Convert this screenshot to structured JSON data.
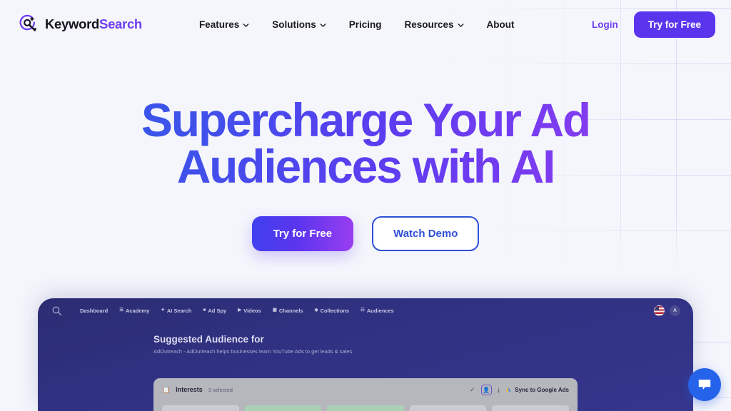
{
  "brand": {
    "name_dark": "Keyword",
    "name_accent": "Search",
    "logo_icon": "target-search-logo"
  },
  "nav": {
    "items": [
      {
        "label": "Features",
        "has_caret": true
      },
      {
        "label": "Solutions",
        "has_caret": true
      },
      {
        "label": "Pricing",
        "has_caret": false
      },
      {
        "label": "Resources",
        "has_caret": true
      },
      {
        "label": "About",
        "has_caret": false
      }
    ],
    "login_label": "Login",
    "cta_label": "Try for Free"
  },
  "hero": {
    "headline": "Supercharge Your Ad Audiences with AI",
    "primary_cta": "Try for Free",
    "secondary_cta": "Watch Demo"
  },
  "dashboard": {
    "search_icon": "search-icon",
    "links": [
      {
        "label": "Dashboard",
        "icon": ""
      },
      {
        "label": "Academy",
        "icon": "☰"
      },
      {
        "label": "AI Search",
        "icon": "✦"
      },
      {
        "label": "Ad Spy",
        "icon": "■"
      },
      {
        "label": "Videos",
        "icon": "▶"
      },
      {
        "label": "Channels",
        "icon": "▣"
      },
      {
        "label": "Collections",
        "icon": "◆"
      },
      {
        "label": "Audiences",
        "icon": "☷"
      }
    ],
    "locale_flag": "us-flag-icon",
    "avatar_initial": "A",
    "title": "Suggested Audience for",
    "subtitle": "AdOutreach - AdOutreach helps businesses learn YouTube Ads to get leads & sales.",
    "interests": {
      "icon": "📋",
      "label": "Interests",
      "count_label": "3 selected",
      "check_icon": "✓",
      "person_icon": "👤",
      "download_icon": "⤓",
      "sync_label": "Sync to Google Ads"
    }
  },
  "chat": {
    "icon": "chat-bubble-icon"
  },
  "colors": {
    "page_bg": "#f5f6fc",
    "grid_line": "#c4c4eb",
    "brand_accent": "#6d3df0",
    "cta_purple": "#5b35ee",
    "headline_gradient_start": "#2f5de8",
    "headline_gradient_end": "#a03df0",
    "secondary_border": "#2f50d8",
    "dashboard_bg": "#303182",
    "chat_blue": "#2563eb"
  }
}
